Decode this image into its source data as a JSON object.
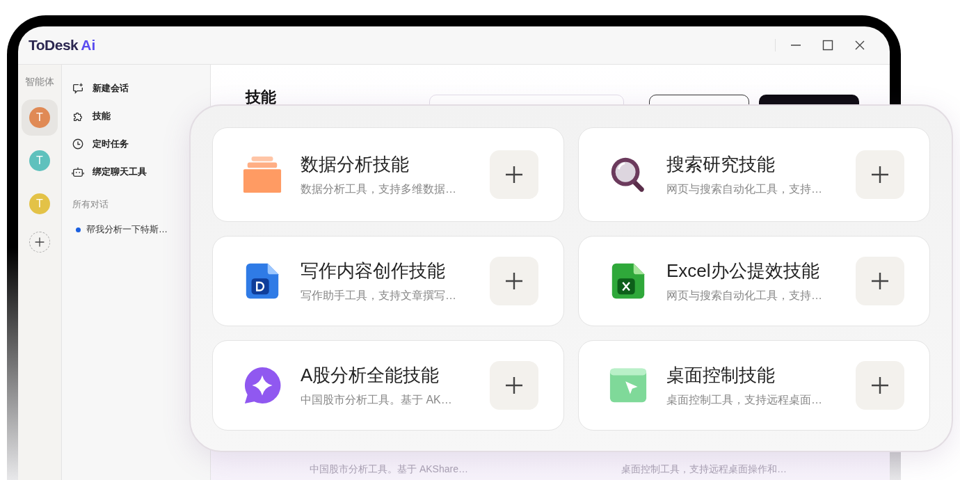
{
  "window": {
    "logo": "ToDesk",
    "logo_suffix": "Ai"
  },
  "agents": {
    "label": "智能体",
    "items": [
      {
        "letter": "T",
        "color": "#e08a55",
        "selected": true
      },
      {
        "letter": "T",
        "color": "#5fc1bd",
        "selected": false
      },
      {
        "letter": "T",
        "color": "#e3c247",
        "selected": false
      }
    ]
  },
  "nav": [
    {
      "kind": "chat",
      "label": "新建会话"
    },
    {
      "kind": "puzzle",
      "label": "技能"
    },
    {
      "kind": "clock",
      "label": "定时任务"
    },
    {
      "kind": "robot",
      "label": "绑定聊天工具"
    }
  ],
  "conversations": {
    "label": "所有对话",
    "items": [
      {
        "title": "帮我分析一下特斯…",
        "color": "#1a5fe0"
      }
    ]
  },
  "main": {
    "title": "技能",
    "behind": [
      "中国股市分析工具。基于 AKShare…",
      "桌面控制工具，支持远程桌面操作和…"
    ]
  },
  "skills": [
    {
      "kind": "stack",
      "title": "数据分析技能",
      "description": "数据分析工具，支持多维数据…"
    },
    {
      "kind": "magnifier",
      "title": "搜索研究技能",
      "description": "网页与搜索自动化工具，支持…"
    },
    {
      "kind": "doc",
      "title": "写作内容创作技能",
      "description": "写作助手工具，支持文章撰写…"
    },
    {
      "kind": "excel",
      "title": "Excel办公提效技能",
      "description": "网页与搜索自动化工具，支持…"
    },
    {
      "kind": "sparkle",
      "title": "A股分析全能技能",
      "description": "中国股市分析工具。基于 AK…"
    },
    {
      "kind": "cursor",
      "title": "桌面控制技能",
      "description": "桌面控制工具，支持远程桌面…"
    }
  ]
}
